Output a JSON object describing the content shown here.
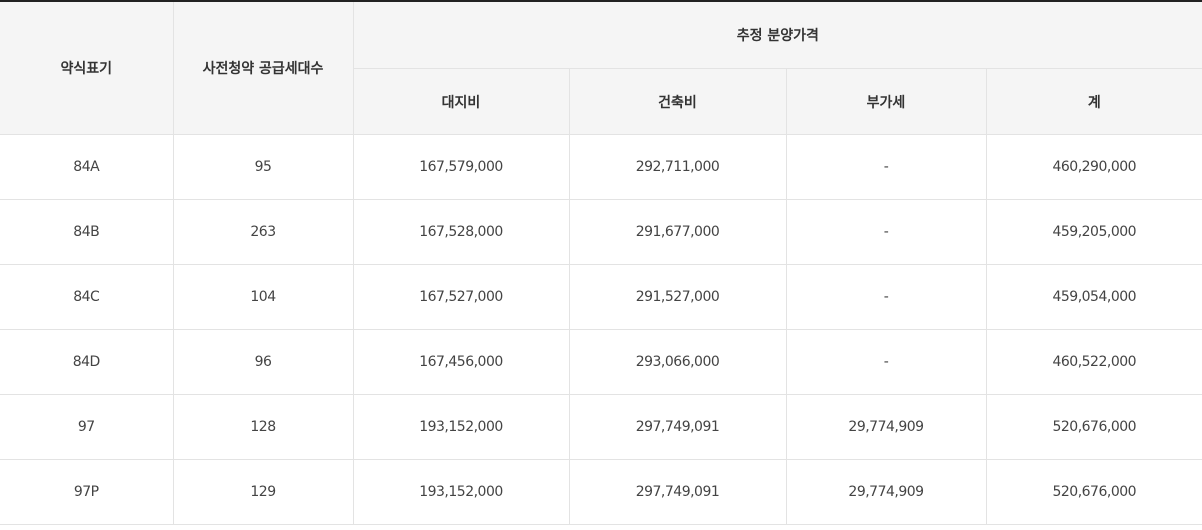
{
  "table": {
    "headers": {
      "type": "약식표기",
      "units": "사전청약 공급세대수",
      "price_group": "추정 분양가격",
      "land": "대지비",
      "building": "건축비",
      "vat": "부가세",
      "total": "계"
    },
    "rows": [
      {
        "type": "84A",
        "units": "95",
        "land": "167,579,000",
        "building": "292,711,000",
        "vat": "-",
        "total": "460,290,000"
      },
      {
        "type": "84B",
        "units": "263",
        "land": "167,528,000",
        "building": "291,677,000",
        "vat": "-",
        "total": "459,205,000"
      },
      {
        "type": "84C",
        "units": "104",
        "land": "167,527,000",
        "building": "291,527,000",
        "vat": "-",
        "total": "459,054,000"
      },
      {
        "type": "84D",
        "units": "96",
        "land": "167,456,000",
        "building": "293,066,000",
        "vat": "-",
        "total": "460,522,000"
      },
      {
        "type": "97",
        "units": "128",
        "land": "193,152,000",
        "building": "297,749,091",
        "vat": "29,774,909",
        "total": "520,676,000"
      },
      {
        "type": "97P",
        "units": "129",
        "land": "193,152,000",
        "building": "297,749,091",
        "vat": "29,774,909",
        "total": "520,676,000"
      }
    ]
  }
}
